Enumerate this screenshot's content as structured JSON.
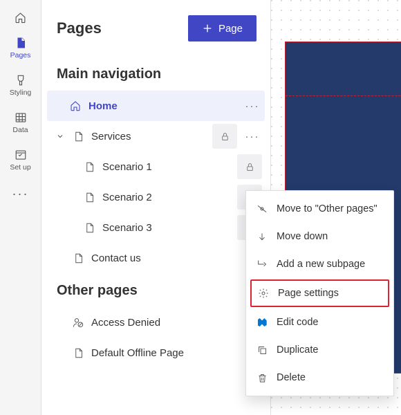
{
  "rail": {
    "items": [
      {
        "label": "Pages"
      },
      {
        "label": "Styling"
      },
      {
        "label": "Data"
      },
      {
        "label": "Set up"
      }
    ]
  },
  "panel": {
    "title": "Pages",
    "add_label": "Page",
    "section_main": "Main navigation",
    "section_other": "Other pages",
    "tree": {
      "home": "Home",
      "services": "Services",
      "scenario1": "Scenario 1",
      "scenario2": "Scenario 2",
      "scenario3": "Scenario 3",
      "contact": "Contact us",
      "access_denied": "Access Denied",
      "default_offline": "Default Offline Page"
    }
  },
  "menu": {
    "move_other": "Move to \"Other pages\"",
    "move_down": "Move down",
    "add_sub": "Add a new subpage",
    "settings": "Page settings",
    "edit_code": "Edit code",
    "duplicate": "Duplicate",
    "delete": "Delete"
  }
}
